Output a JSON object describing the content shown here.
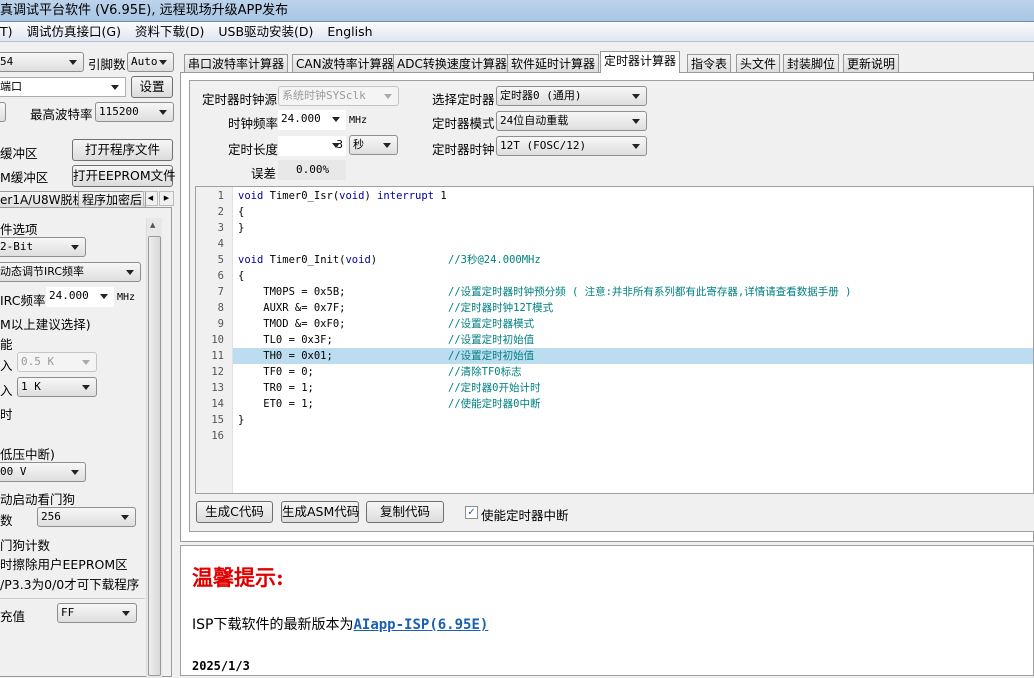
{
  "title": "真调试平台软件 (V6.95E), 远程现场升级APP发布",
  "menu": [
    "T)",
    "调试仿真接口(G)",
    "资料下载(D)",
    "USB驱动安装(D)",
    "English"
  ],
  "left": {
    "mcu_select": "54",
    "pin_label": "引脚数",
    "pin_select": "Auto",
    "port_select": "端口",
    "settings_button": "设置",
    "baud_label": "最高波特率",
    "baud_select": "115200",
    "code_buffer": "缓冲区",
    "open_program": "打开程序文件",
    "eeprom_buffer": "M缓冲区",
    "open_eeprom": "打开EEPROM文件",
    "tabs": [
      "er1A/U8W脱机",
      "程序加密后"
    ],
    "options": {
      "hw_title": "件选项",
      "bit_select": "2-Bit",
      "irc_mode": "动态调节IRC频率",
      "irc_label": "IRC频率",
      "irc_value": "24.000",
      "irc_unit": "MHz",
      "note": "M以上建议选择)",
      "line_a": "能",
      "in1": "入",
      "in1_value": "0.5 K",
      "in2": "入",
      "in2_value": "1  K",
      "delay": "时",
      "lvd": "低压中断)",
      "lvd_value": "00 V",
      "wdt": "动启动看门狗",
      "wdt_div": "数",
      "wdt_div_value": "256",
      "wdt_count": "门狗计数",
      "erase": "时擦除用户EEPROM区",
      "p33": "/P3.3为0/0才可下载程序",
      "fill": "充值",
      "fill_value": "FF"
    }
  },
  "tabs": [
    "串口波特率计算器",
    "CAN波特率计算器",
    "ADC转换速度计算器",
    "软件延时计算器",
    "定时器计算器",
    "指令表",
    "头文件",
    "封装脚位",
    "更新说明"
  ],
  "active_tab": 4,
  "timer": {
    "clk_src_label": "定时器时钟源",
    "clk_src": "系统时钟SYSclk",
    "freq_label": "时钟频率",
    "freq": "24.000",
    "freq_unit": "MHz",
    "len_label": "定时长度",
    "len": "3",
    "len_unit": "秒",
    "err_label": "误差",
    "err": "0.00%",
    "sel_label": "选择定时器",
    "sel": "定时器0 (通用)",
    "mode_label": "定时器模式",
    "mode": "24位自动重载",
    "tclk_label": "定时器时钟",
    "tclk": "12T (FOSC/12)"
  },
  "code": [
    {
      "c": "void Timer0_Isr(void) interrupt 1",
      "m": ""
    },
    {
      "c": "{",
      "m": ""
    },
    {
      "c": "}",
      "m": ""
    },
    {
      "c": "",
      "m": ""
    },
    {
      "c": "void Timer0_Init(void)",
      "m": "//3秒@24.000MHz"
    },
    {
      "c": "{",
      "m": ""
    },
    {
      "c": "    TM0PS = 0x5B;",
      "m": "//设置定时器时钟预分频 ( 注意:并非所有系列都有此寄存器,详情请查看数据手册 )"
    },
    {
      "c": "    AUXR &= 0x7F;",
      "m": "//定时器时钟12T模式"
    },
    {
      "c": "    TMOD &= 0xF0;",
      "m": "//设置定时器模式"
    },
    {
      "c": "    TL0 = 0x3F;",
      "m": "//设置定时初始值"
    },
    {
      "c": "    TH0 = 0x01;",
      "m": "//设置定时初始值"
    },
    {
      "c": "    TF0 = 0;",
      "m": "//清除TF0标志"
    },
    {
      "c": "    TR0 = 1;",
      "m": "//定时器0开始计时"
    },
    {
      "c": "    ET0 = 1;",
      "m": "//使能定时器0中断"
    },
    {
      "c": "}",
      "m": ""
    },
    {
      "c": "",
      "m": ""
    }
  ],
  "highlight_line": 11,
  "actions": {
    "gen_c": "生成C代码",
    "gen_asm": "生成ASM代码",
    "copy": "复制代码",
    "enable_int": "使能定时器中断",
    "enable_int_checked": true
  },
  "notice": {
    "title": "温馨提示:",
    "text": "ISP下载软件的最新版本为",
    "link": "AIapp-ISP(6.95E)",
    "date": "2025/1/3",
    "title_color": "#e00000",
    "link_color": "#1a5fb4"
  }
}
